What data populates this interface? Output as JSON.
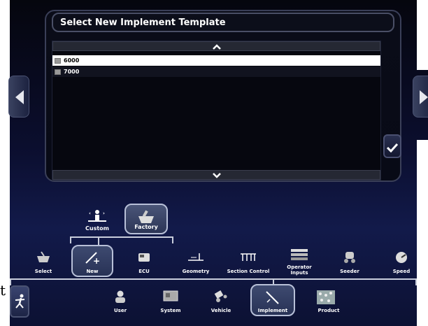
{
  "dialog": {
    "title": "Select New Implement Template",
    "items": [
      {
        "label": "6000",
        "selected": true
      },
      {
        "label": "7000",
        "selected": false
      }
    ],
    "scroll_up_icon": "chevron-up-icon",
    "scroll_down_icon": "chevron-down-icon",
    "confirm_icon": "checkmark-icon"
  },
  "sub_options": [
    {
      "label": "Custom",
      "selected": false
    },
    {
      "label": "Factory",
      "selected": true
    }
  ],
  "tools": [
    {
      "label": "Select",
      "selected": false
    },
    {
      "label": "New",
      "selected": true
    },
    {
      "label": "ECU",
      "selected": false
    },
    {
      "label": "Geometry",
      "selected": false
    },
    {
      "label": "Section Control",
      "selected": false
    },
    {
      "label": "Operator Inputs",
      "selected": false
    },
    {
      "label": "Seeder",
      "selected": false
    },
    {
      "label": "Speed",
      "selected": false
    }
  ],
  "main_nav": [
    {
      "label": "User",
      "selected": false
    },
    {
      "label": "System",
      "selected": false
    },
    {
      "label": "Vehicle",
      "selected": false
    },
    {
      "label": "Implement",
      "selected": true
    },
    {
      "label": "Product",
      "selected": false
    }
  ],
  "side_char": "t"
}
